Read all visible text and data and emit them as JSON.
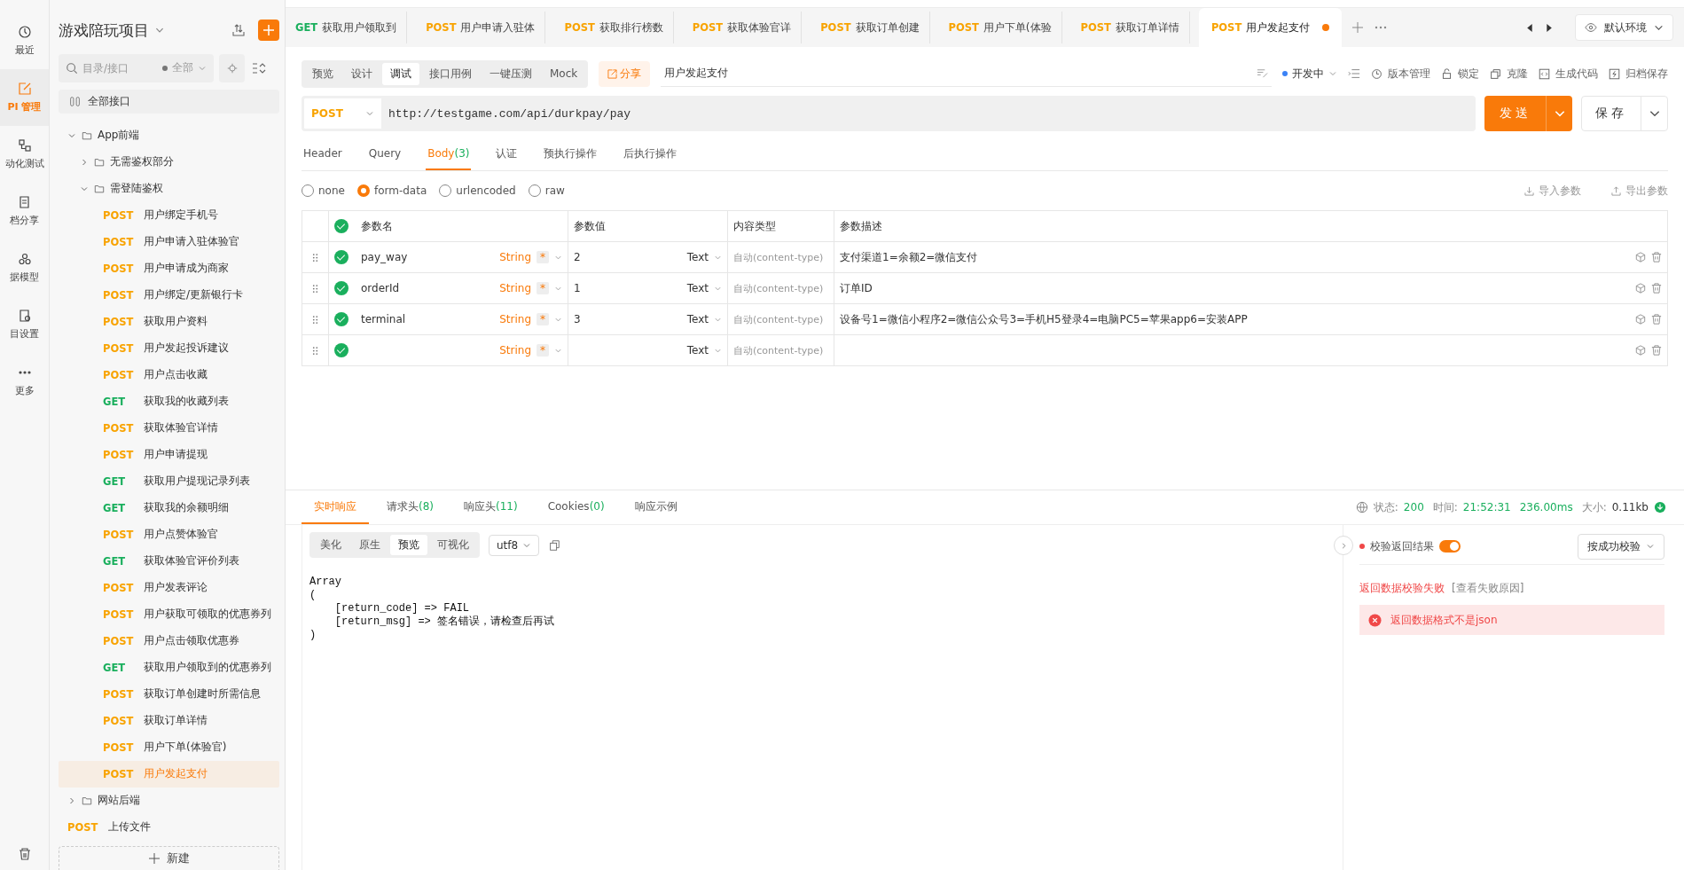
{
  "rail": [
    {
      "kind": "clock",
      "label": "最近",
      "selected": false
    },
    {
      "kind": "edit",
      "label": "PI 管理",
      "selected": true
    },
    {
      "kind": "flow",
      "label": "动化测试",
      "selected": false
    },
    {
      "kind": "doc",
      "label": "档分享",
      "selected": false
    },
    {
      "kind": "model",
      "label": "据模型",
      "selected": false
    },
    {
      "kind": "settings",
      "label": "目设置",
      "selected": false
    },
    {
      "kind": "more",
      "label": "更多",
      "selected": false
    }
  ],
  "sidebar": {
    "project": "游戏陪玩项目",
    "search_placeholder": "目录/接口",
    "filter": "全部",
    "all_label": "全部接口",
    "new_label": "新建",
    "tree": [
      {
        "kind": "folder",
        "label": "App前端",
        "expanded": true,
        "children": [
          {
            "kind": "folder",
            "label": "无需鉴权部分",
            "expanded": false
          },
          {
            "kind": "folder",
            "label": "需登陆鉴权",
            "expanded": true,
            "children": [
              {
                "kind": "api",
                "method": "POST",
                "label": "用户绑定手机号",
                "selected": false
              },
              {
                "kind": "api",
                "method": "POST",
                "label": "用户申请入驻体验官",
                "selected": false
              },
              {
                "kind": "api",
                "method": "POST",
                "label": "用户申请成为商家",
                "selected": false
              },
              {
                "kind": "api",
                "method": "POST",
                "label": "用户绑定/更新银行卡",
                "selected": false
              },
              {
                "kind": "api",
                "method": "POST",
                "label": "获取用户资料",
                "selected": false
              },
              {
                "kind": "api",
                "method": "POST",
                "label": "用户发起投诉建议",
                "selected": false
              },
              {
                "kind": "api",
                "method": "POST",
                "label": "用户点击收藏",
                "selected": false
              },
              {
                "kind": "api",
                "method": "GET",
                "label": "获取我的收藏列表",
                "selected": false
              },
              {
                "kind": "api",
                "method": "POST",
                "label": "获取体验官详情",
                "selected": false
              },
              {
                "kind": "api",
                "method": "POST",
                "label": "用户申请提现",
                "selected": false
              },
              {
                "kind": "api",
                "method": "GET",
                "label": "获取用户提现记录列表",
                "selected": false
              },
              {
                "kind": "api",
                "method": "GET",
                "label": "获取我的余额明细",
                "selected": false
              },
              {
                "kind": "api",
                "method": "POST",
                "label": "用户点赞体验官",
                "selected": false
              },
              {
                "kind": "api",
                "method": "GET",
                "label": "获取体验官评价列表",
                "selected": false
              },
              {
                "kind": "api",
                "method": "POST",
                "label": "用户发表评论",
                "selected": false
              },
              {
                "kind": "api",
                "method": "POST",
                "label": "用户获取可领取的优惠券列",
                "selected": false
              },
              {
                "kind": "api",
                "method": "POST",
                "label": "用户点击领取优惠券",
                "selected": false
              },
              {
                "kind": "api",
                "method": "GET",
                "label": "获取用户领取到的优惠券列",
                "selected": false
              },
              {
                "kind": "api",
                "method": "POST",
                "label": "获取订单创建时所需信息",
                "selected": false
              },
              {
                "kind": "api",
                "method": "POST",
                "label": "获取订单详情",
                "selected": false
              },
              {
                "kind": "api",
                "method": "POST",
                "label": "用户下单(体验官)",
                "selected": false
              },
              {
                "kind": "api",
                "method": "POST",
                "label": "用户发起支付",
                "selected": true
              }
            ]
          }
        ]
      },
      {
        "kind": "folder",
        "label": "网站后端",
        "expanded": false
      },
      {
        "kind": "api",
        "method": "POST",
        "label": "上传文件",
        "selected": false
      }
    ]
  },
  "tabs": [
    {
      "method": "GET",
      "label": "获取用户领取到",
      "selected": false,
      "unsaved": false
    },
    {
      "method": "POST",
      "label": "用户申请入驻体",
      "selected": false,
      "unsaved": false
    },
    {
      "method": "POST",
      "label": "获取排行榜数",
      "selected": false,
      "unsaved": false
    },
    {
      "method": "POST",
      "label": "获取体验官详",
      "selected": false,
      "unsaved": false
    },
    {
      "method": "POST",
      "label": "获取订单创建",
      "selected": false,
      "unsaved": false
    },
    {
      "method": "POST",
      "label": "用户下单(体验",
      "selected": false,
      "unsaved": false
    },
    {
      "method": "POST",
      "label": "获取订单详情",
      "selected": false,
      "unsaved": false
    },
    {
      "method": "POST",
      "label": "用户发起支付",
      "selected": true,
      "unsaved": true
    }
  ],
  "environment": "默认环境",
  "modes": [
    {
      "label": "预览",
      "selected": false
    },
    {
      "label": "设计",
      "selected": false
    },
    {
      "label": "调试",
      "selected": true
    },
    {
      "label": "接口用例",
      "selected": false
    },
    {
      "label": "一键压测",
      "selected": false
    },
    {
      "label": "Mock",
      "selected": false
    }
  ],
  "share": "分享",
  "api_name": "用户发起支付",
  "status": "开发中",
  "actions": [
    {
      "kind": "clock",
      "label": "版本管理"
    },
    {
      "kind": "lock",
      "label": "锁定"
    },
    {
      "kind": "copy",
      "label": "克隆"
    },
    {
      "kind": "code",
      "label": "生成代码"
    },
    {
      "kind": "archive",
      "label": "归档保存"
    }
  ],
  "request": {
    "method": "POST",
    "url": "http://testgame.com/api/durkpay/pay",
    "send": "发送",
    "save": "保存"
  },
  "subtabs": [
    {
      "label": "Header",
      "selected": false
    },
    {
      "label": "Query",
      "selected": false
    },
    {
      "label": "Body",
      "count": "(3)",
      "selected": true
    },
    {
      "label": "认证",
      "selected": false
    },
    {
      "label": "预执行操作",
      "selected": false
    },
    {
      "label": "后执行操作",
      "selected": false
    }
  ],
  "body_types": [
    {
      "label": "none",
      "selected": false
    },
    {
      "label": "form-data",
      "selected": true
    },
    {
      "label": "urlencoded",
      "selected": false
    },
    {
      "label": "raw",
      "selected": false
    }
  ],
  "import": "导入参数",
  "export": "导出参数",
  "table": {
    "columns": [
      "参数名",
      "参数值",
      "内容类型",
      "参数描述"
    ],
    "all_checked": true,
    "rows": [
      {
        "checked": true,
        "name": "pay_way",
        "type": "String",
        "required": "*",
        "value": "2",
        "value_type": "Text",
        "content_type": "自动(content-type)",
        "description": "支付渠道1=余额2=微信支付"
      },
      {
        "checked": true,
        "name": "orderId",
        "type": "String",
        "required": "*",
        "value": "1",
        "value_type": "Text",
        "content_type": "自动(content-type)",
        "description": "订单ID"
      },
      {
        "checked": true,
        "name": "terminal",
        "type": "String",
        "required": "*",
        "value": "3",
        "value_type": "Text",
        "content_type": "自动(content-type)",
        "description": "设备号1=微信小程序2=微信公众号3=手机H5登录4=电脑PC5=苹果app6=安装APP"
      },
      {
        "checked": true,
        "name": "",
        "type": "String",
        "required": "*",
        "value": "",
        "value_type": "Text",
        "content_type": "自动(content-type)",
        "description": ""
      }
    ]
  },
  "response": {
    "tabs": [
      {
        "label": "实时响应",
        "selected": true
      },
      {
        "label": "请求头",
        "count": "(8)",
        "selected": false
      },
      {
        "label": "响应头",
        "count": "(11)",
        "selected": false
      },
      {
        "label": "Cookies",
        "count": "(0)",
        "selected": false
      },
      {
        "label": "响应示例",
        "selected": false
      }
    ],
    "status_label": "状态:",
    "status": "200",
    "time_label": "时间:",
    "time": "21:52:31",
    "duration": "236.00ms",
    "size_label": "大小:",
    "size": "0.11kb",
    "views": [
      {
        "label": "美化",
        "selected": false
      },
      {
        "label": "原生",
        "selected": false
      },
      {
        "label": "预览",
        "selected": true
      },
      {
        "label": "可视化",
        "selected": false
      }
    ],
    "encoding": "utf8",
    "body": [
      "Array",
      "(",
      "    [return_code] => FAIL",
      "    [return_msg] => 签名错误，请检查后再试",
      ")"
    ],
    "validate_label": "校验返回结果",
    "validate_on": true,
    "validate_mode": "按成功校验",
    "fail_title": "返回数据校验失败",
    "fail_link": "[查看失败原因]",
    "error": "返回数据格式不是json"
  }
}
